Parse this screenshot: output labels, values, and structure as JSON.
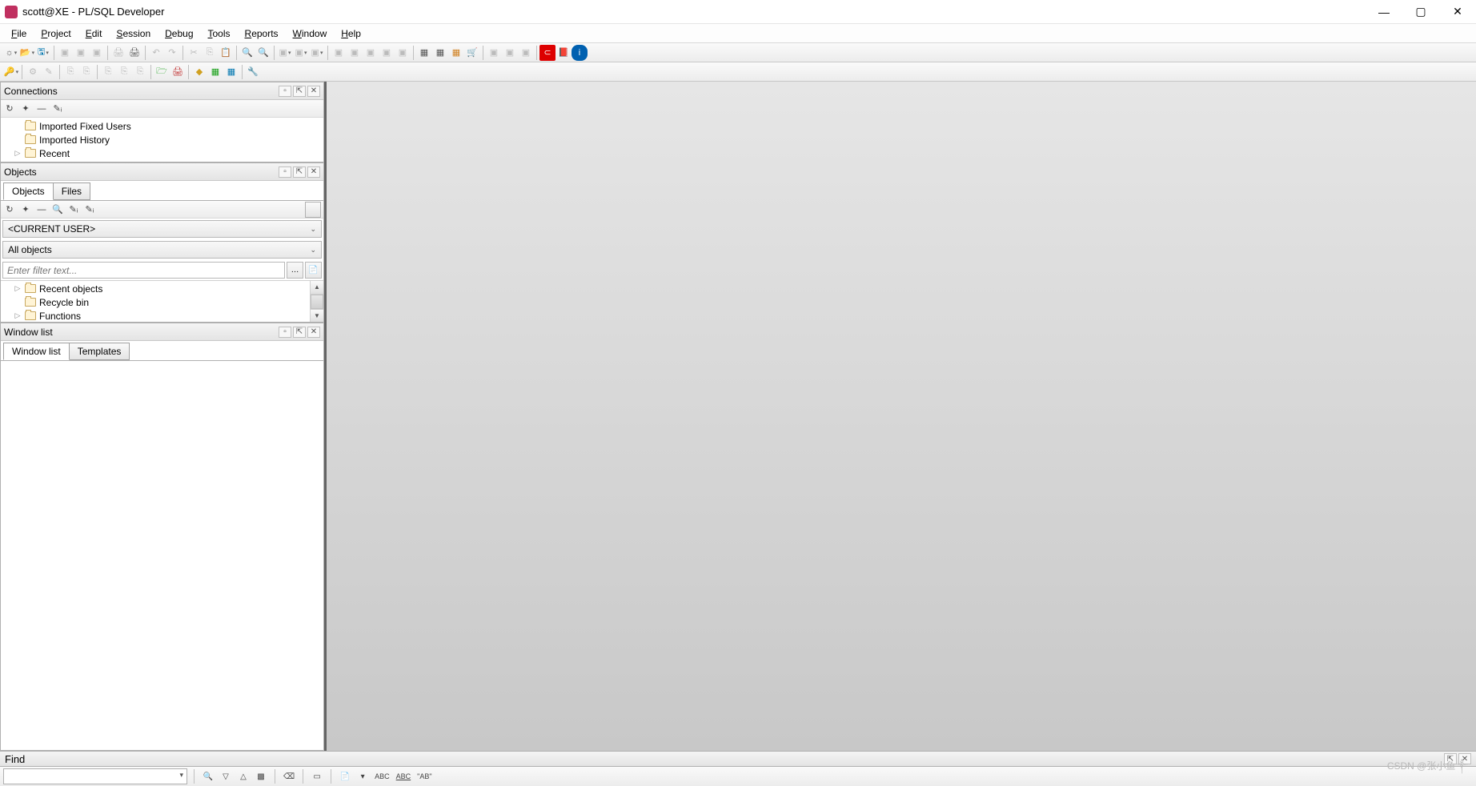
{
  "window": {
    "title": "scott@XE - PL/SQL Developer"
  },
  "menu": {
    "file": "File",
    "project": "Project",
    "edit": "Edit",
    "session": "Session",
    "debug": "Debug",
    "tools": "Tools",
    "reports": "Reports",
    "window": "Window",
    "help": "Help"
  },
  "panels": {
    "connections": {
      "title": "Connections",
      "items": [
        "Imported Fixed Users",
        "Imported History",
        "Recent"
      ]
    },
    "objects": {
      "title": "Objects",
      "tabs": {
        "objects": "Objects",
        "files": "Files"
      },
      "user_combo": "<CURRENT USER>",
      "scope_combo": "All objects",
      "filter_placeholder": "Enter filter text...",
      "tree": [
        "Recent objects",
        "Recycle bin",
        "Functions"
      ]
    },
    "windowlist": {
      "title": "Window list",
      "tabs": {
        "windowlist": "Window list",
        "templates": "Templates"
      }
    }
  },
  "find": {
    "title": "Find",
    "label_abc": "ABC",
    "label_abcstrike": "ABC",
    "label_ab": "\"AB\""
  },
  "watermark": "CSDN @张小鱼༒"
}
